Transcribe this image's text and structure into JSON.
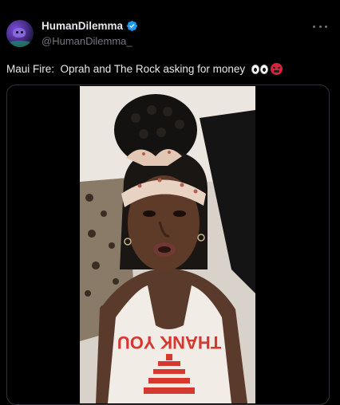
{
  "tweet": {
    "display_name": "HumanDilemma",
    "handle": "@HumanDilemma_",
    "text": "Maui Fire:  Oprah and The Rock asking for money",
    "emojis": [
      "eyes-emoji",
      "angry-face-emoji"
    ],
    "verified_color": "#1d9bf0"
  },
  "media": {
    "type": "video",
    "shirt_text": "THANK YOU"
  },
  "colors": {
    "background": "#000000",
    "text_primary": "#e7e9ea",
    "text_secondary": "#71767b",
    "border": "#2f3336"
  }
}
